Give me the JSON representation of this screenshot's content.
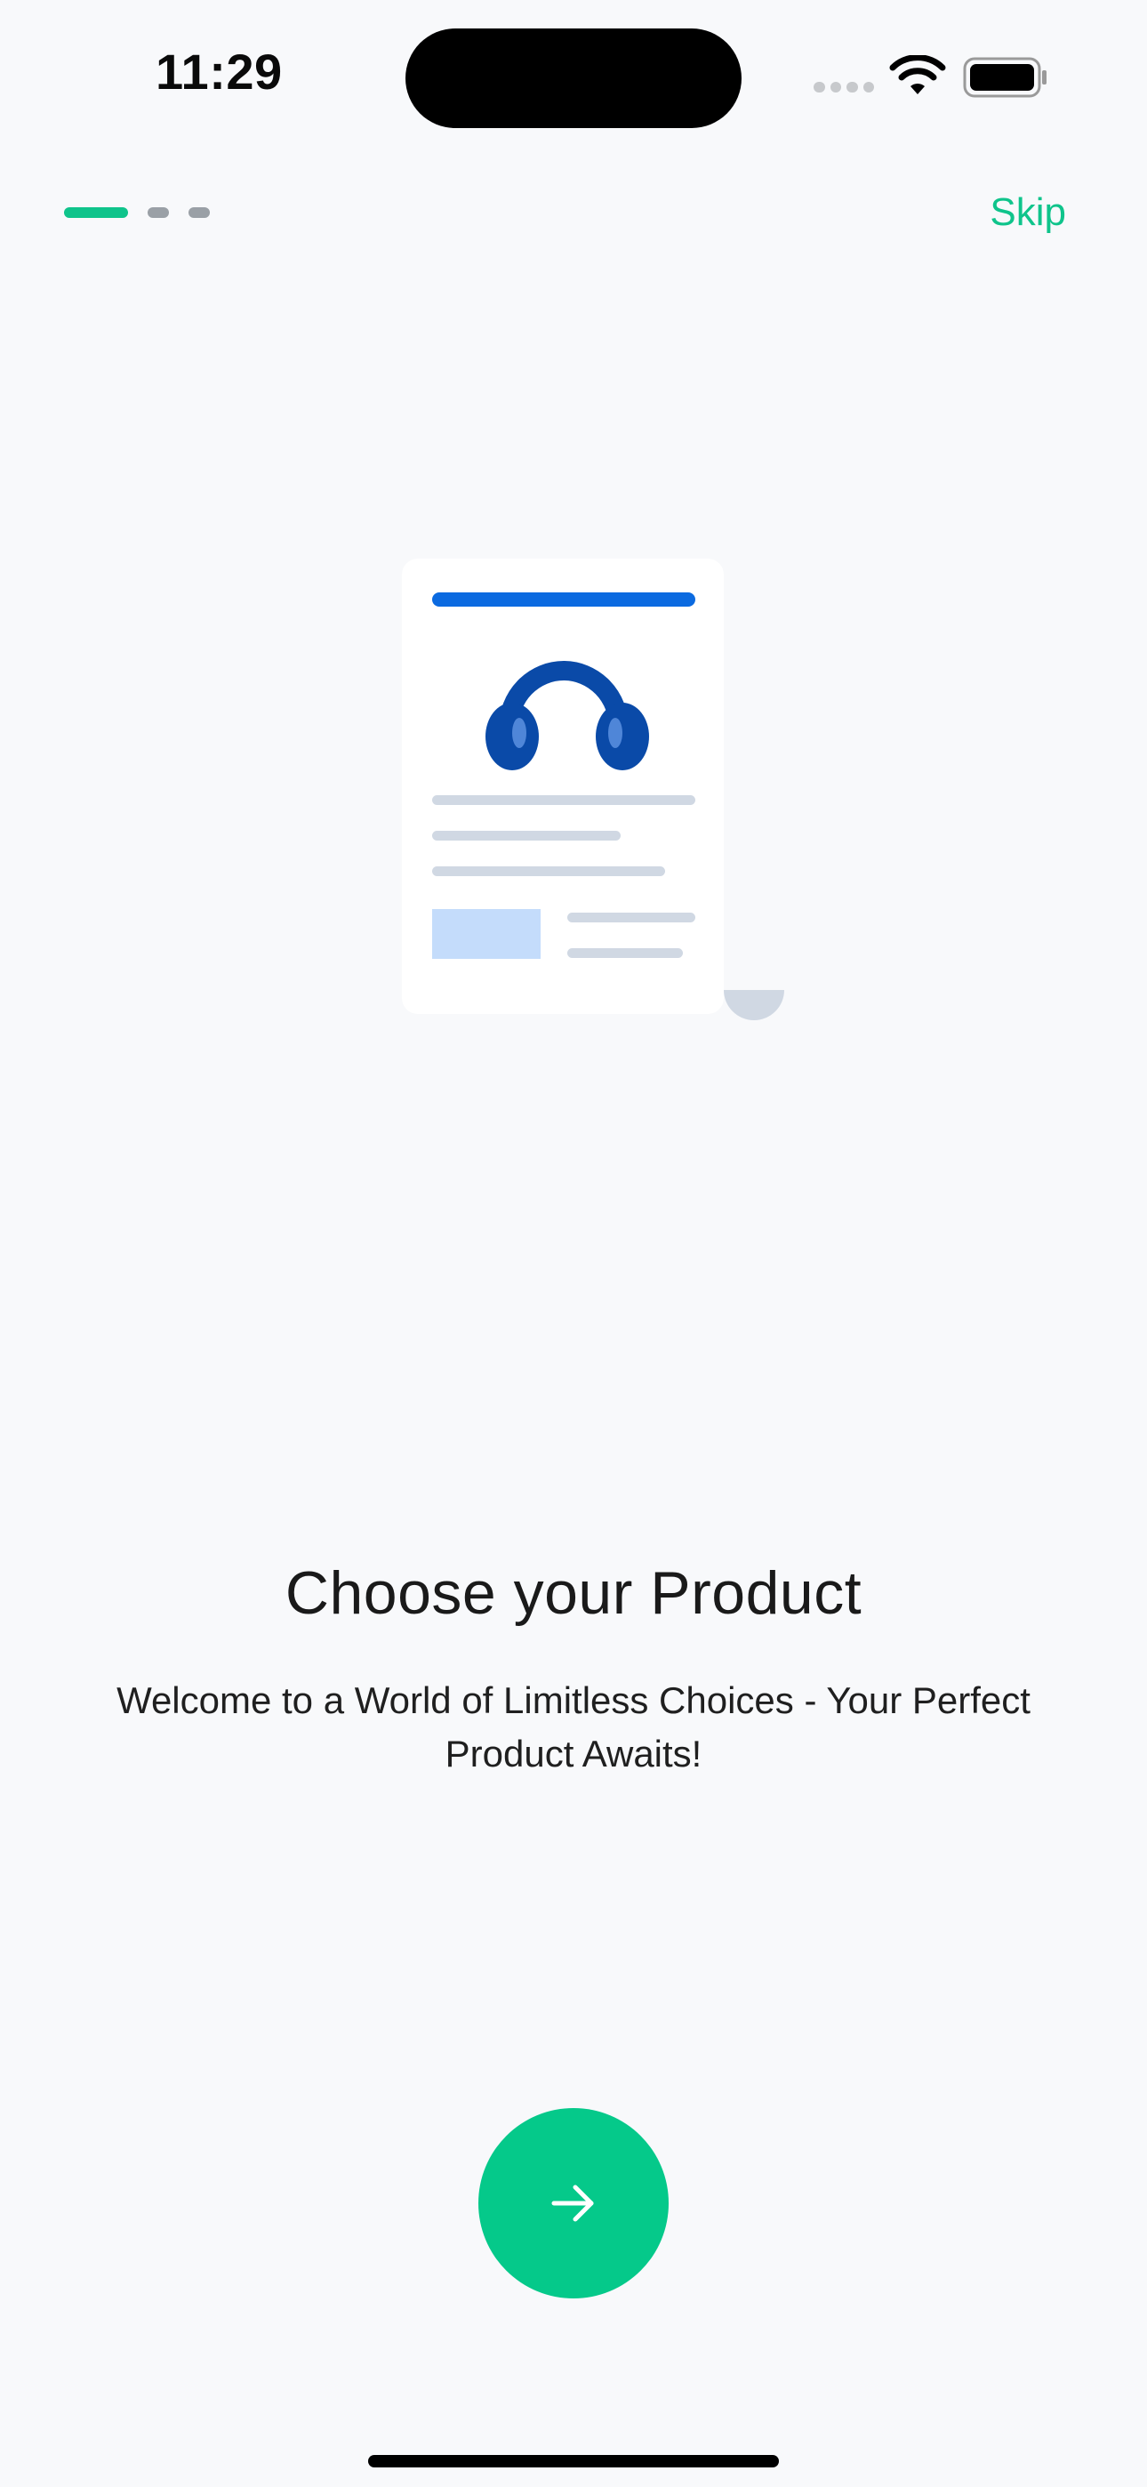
{
  "status_bar": {
    "time": "11:29"
  },
  "onboarding": {
    "pager": {
      "total": 3,
      "active_index": 0
    },
    "skip_label": "Skip",
    "title": "Choose your Product",
    "subtitle": "Welcome to a World of Limitless Choices - Your Perfect Product Awaits!",
    "next_icon": "arrow-right-icon"
  },
  "illustration": {
    "subject": "headphones-icon"
  },
  "colors": {
    "accent": "#05c98a",
    "illustration_blue": "#0a4aa8",
    "header_bar_blue": "#0b6ae0",
    "placeholder_blue": "#c4dcfb",
    "line_gray": "#d0d8e3",
    "background": "#f8f9fb"
  }
}
